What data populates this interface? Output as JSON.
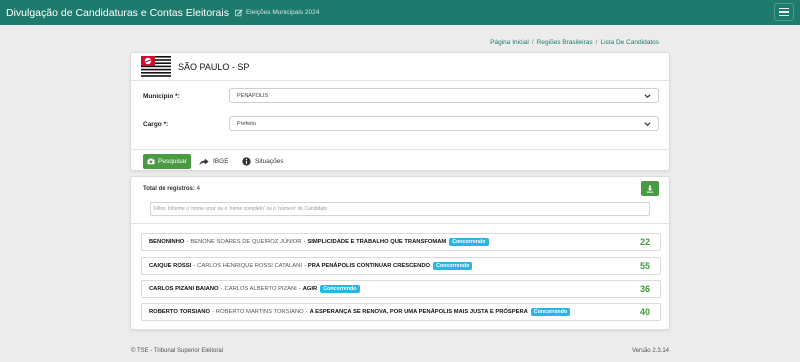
{
  "header": {
    "title": "Divulgação de Candidaturas e Contas Eleitorais",
    "subtitle": "Eleições Municipais 2024",
    "edit_icon": "edit-icon",
    "menu_icon": "hamburger-icon"
  },
  "breadcrumb": [
    "Página Inicial",
    "Regiões Brasileiras",
    "Lista De Candidatos"
  ],
  "state": {
    "name": "SÃO PAULO - SP",
    "flag_icon": "sao-paulo-flag"
  },
  "form": {
    "municipio_label": "Município *:",
    "municipio_value": "PENÁPOLIS",
    "cargo_label": "Cargo *:",
    "cargo_value": "Prefeito"
  },
  "actions": {
    "search_label": "Pesquisar",
    "search_icon": "camera-icon",
    "ibge_label": "IBGE",
    "ibge_icon": "share-arrow-icon",
    "situacoes_label": "Situações",
    "situacoes_icon": "info-icon"
  },
  "results": {
    "total_label": "Total de registros:",
    "total_value": "4",
    "download_icon": "download-icon",
    "filter_placeholder": "Filtro: Informe o 'nome urna' ou o 'nome completo' ou o 'número' do Candidato",
    "candidates": [
      {
        "urna": "BENONINHO",
        "fullname": "BENONE SOARES DE QUEIROZ JÚNIOR",
        "coalition": "SIMPLICIDADE E TRABALHO QUE TRANSFOMAM",
        "status": "Concorrendo",
        "number": "22"
      },
      {
        "urna": "CAIQUE ROSSI",
        "fullname": "CARLOS HENRIQUE ROSSI CATALANI",
        "coalition": "PRA PENÁPOLIS CONTINUAR CRESCENDO",
        "status": "Concorrendo",
        "number": "55"
      },
      {
        "urna": "CARLOS PIZANI BAIANO",
        "fullname": "CARLOS ALBERTO PIZANI",
        "coalition": "AGIR",
        "status": "Concorrendo",
        "number": "36"
      },
      {
        "urna": "ROBERTO TORSIANO",
        "fullname": "ROBERTO MARTINS TORSIANO",
        "coalition": "A ESPERANÇA SE RENOVA, POR UMA PENÁPOLIS MAIS JUSTA E PRÓSPERA",
        "status": "Concorrendo",
        "number": "40"
      }
    ]
  },
  "footer": {
    "left": "© TSE - Tribunal Superior Eleitoral",
    "right": "Versão 2.3.14"
  },
  "colors": {
    "header_bg": "#1f7a6e",
    "primary_green": "#4a9a43",
    "badge_blue": "#2bb4e6",
    "number_green": "#3f9a3a"
  }
}
